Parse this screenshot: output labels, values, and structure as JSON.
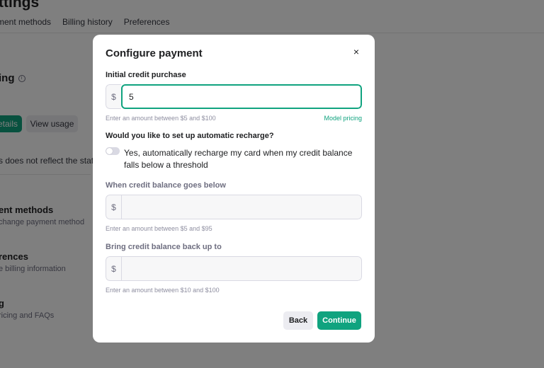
{
  "background": {
    "title": "ttings",
    "tabs": [
      "ment methods",
      "Billing history",
      "Preferences"
    ],
    "heading": "ing",
    "info_icon": "i",
    "details_button": "etails",
    "view_usage_button": "View usage",
    "warning_text": "s does not reflect the status",
    "items": [
      {
        "title": "ent methods",
        "subtitle": "change payment method"
      },
      {
        "title": "rences",
        "subtitle": "e billing information"
      },
      {
        "title": "g",
        "subtitle": "ricing and FAQs"
      }
    ]
  },
  "modal": {
    "title": "Configure payment",
    "close_icon": "×",
    "initial_credit": {
      "label": "Initial credit purchase",
      "prefix": "$",
      "value": "5",
      "helper": "Enter an amount between $5 and $100",
      "link": "Model pricing"
    },
    "recharge_question": "Would you like to set up automatic recharge?",
    "recharge_toggle_label": "Yes, automatically recharge my card when my credit balance falls below a threshold",
    "threshold": {
      "label": "When credit balance goes below",
      "prefix": "$",
      "value": "",
      "helper": "Enter an amount between $5 and $95"
    },
    "recharge_to": {
      "label": "Bring credit balance back up to",
      "prefix": "$",
      "value": "",
      "helper": "Enter an amount between $10 and $100"
    },
    "back_button": "Back",
    "continue_button": "Continue"
  },
  "colors": {
    "accent": "#10a37f",
    "overlay": "rgba(0,0,0,0.5)"
  }
}
